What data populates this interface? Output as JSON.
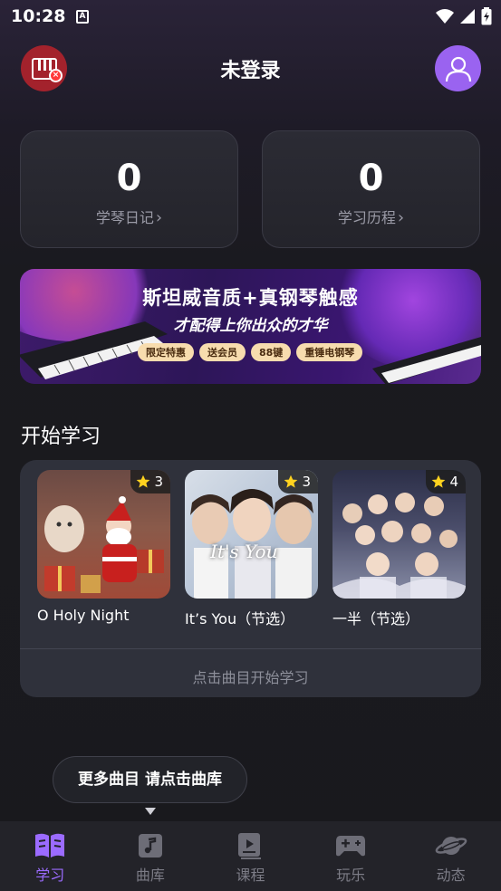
{
  "status_bar": {
    "time": "10:28",
    "a_icon": "A"
  },
  "header": {
    "title": "未登录",
    "logo_badge": "×"
  },
  "stats": [
    {
      "value": "0",
      "label": "学琴日记"
    },
    {
      "value": "0",
      "label": "学习历程"
    }
  ],
  "banner": {
    "title": "斯坦威音质+真钢琴触感",
    "subtitle": "才配得上你出众的才华",
    "tags": [
      "限定特惠",
      "送会员",
      "88键",
      "重锤电钢琴"
    ]
  },
  "section": {
    "title": "开始学习",
    "hint": "点击曲目开始学习"
  },
  "songs": [
    {
      "name": "O Holy Night",
      "stars": "3"
    },
    {
      "name": "It’s You（节选）",
      "stars": "3",
      "cover_text": "It's You"
    },
    {
      "name": "一半（节选）",
      "stars": "4"
    }
  ],
  "tooltip": {
    "text": "更多曲目 请点击曲库"
  },
  "nav": [
    {
      "label": "学习",
      "icon": "book-icon",
      "active": true
    },
    {
      "label": "曲库",
      "icon": "music-note-icon"
    },
    {
      "label": "课程",
      "icon": "video-course-icon"
    },
    {
      "label": "玩乐",
      "icon": "gamepad-icon"
    },
    {
      "label": "动态",
      "icon": "planet-icon"
    }
  ],
  "colors": {
    "accent": "#9b6bff",
    "logo_bg": "#a3222c",
    "avatar_bg": "#9a63f0",
    "star": "#ffd21f"
  }
}
